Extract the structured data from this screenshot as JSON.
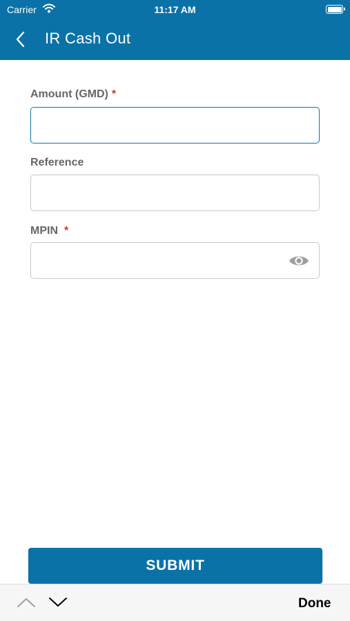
{
  "status_bar": {
    "carrier": "Carrier",
    "time": "11:17 AM"
  },
  "nav": {
    "title": "IR Cash Out"
  },
  "form": {
    "amount": {
      "label": "Amount (GMD)",
      "required_mark": "*",
      "value": "",
      "placeholder": ""
    },
    "reference": {
      "label": "Reference",
      "value": "",
      "placeholder": ""
    },
    "mpin": {
      "label": "MPIN",
      "required_mark": "*",
      "value": "",
      "placeholder": ""
    }
  },
  "submit_label": "SUBMIT",
  "keyboard_toolbar": {
    "done_label": "Done"
  },
  "colors": {
    "primary": "#0b72a8",
    "required": "#d32f2f",
    "label": "#666666"
  },
  "icons": [
    "wifi-icon",
    "battery-icon",
    "back-chevron-icon",
    "eye-icon",
    "chevron-up-icon",
    "chevron-down-icon"
  ]
}
